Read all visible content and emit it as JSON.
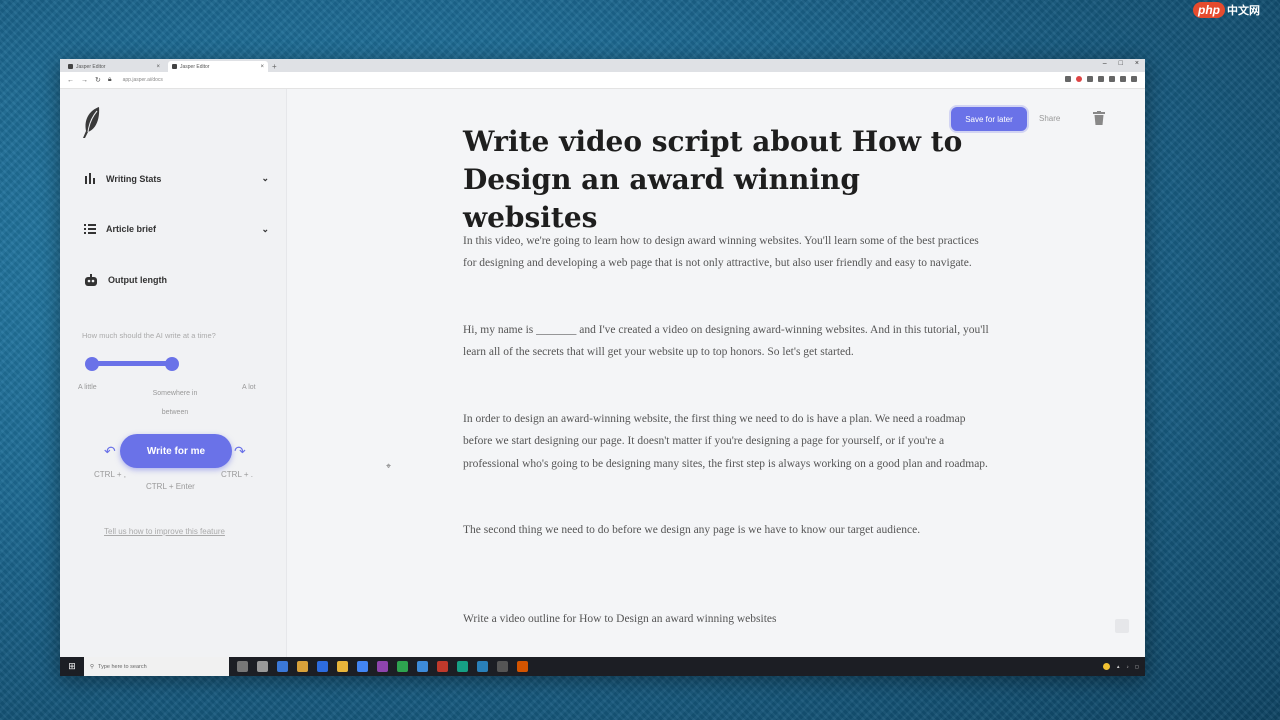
{
  "watermark": {
    "brand": "php",
    "site": "中文网"
  },
  "browser": {
    "tabs": [
      {
        "label": "Jasper Editor"
      },
      {
        "label": "Jasper Editor"
      }
    ],
    "url": "app.jasper.ai/docs"
  },
  "sidebar": {
    "writing_stats": "Writing Stats",
    "article_brief": "Article brief",
    "output_length": "Output length",
    "output_question": "How much should the AI write at a time?",
    "scale": {
      "left": "A little",
      "middle": "Somewhere in between",
      "right": "A lot"
    },
    "length_value": 0.5,
    "write_button": "Write for me",
    "undo_shortcut": "CTRL + ,",
    "compose_shortcut": "CTRL + Enter",
    "redo_shortcut": "CTRL + .",
    "feedback_link": "Tell us how to improve this feature"
  },
  "toolbar": {
    "save_label": "Save for later",
    "share_label": "Share"
  },
  "document": {
    "title": "Write video script about How to Design an award winning websites",
    "paragraphs": [
      "In this video, we're going to learn how to design award winning websites. You'll learn some of the best practices for designing and developing a web page that is not only attractive, but also user friendly and easy to navigate.",
      "Hi, my name is _______ and I've created a video on designing award-winning websites. And in this tutorial, you'll learn all of the secrets that will get your website up to top honors. So let's get started.",
      "In order to design an award-winning website, the first thing we need to do is have a plan. We need a roadmap before we start designing our page. It doesn't matter if you're designing a page for yourself, or if you're a professional who's going to be designing many sites, the first step is always working on a good plan and roadmap.",
      "The second thing we need to do before we design any page is we have to know our target audience."
    ],
    "prompt": "Write a video outline for How to Design an award winning websites"
  },
  "taskbar": {
    "search_placeholder": "Type here to search"
  }
}
